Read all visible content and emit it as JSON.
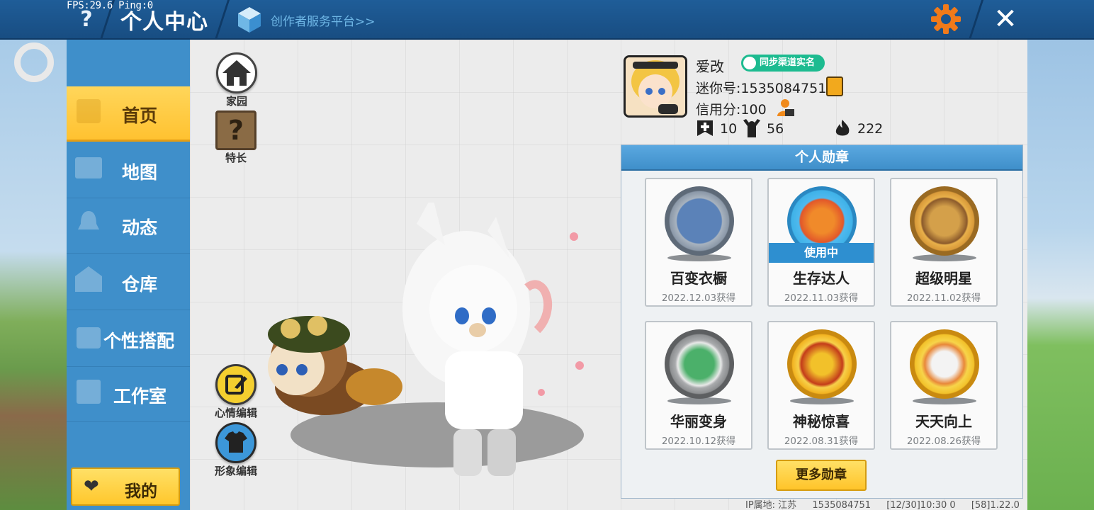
{
  "header": {
    "fps": "FPS:29.6  Ping:0",
    "title": "个人中心",
    "creator_link": "创作者服务平台>>",
    "icons": [
      "help-icon",
      "cube-icon",
      "gear-icon",
      "close-icon"
    ]
  },
  "sidebar": {
    "items": [
      {
        "label": "首页",
        "icon": "home-tile-icon",
        "active": true
      },
      {
        "label": "地图",
        "icon": "map-icon",
        "active": false
      },
      {
        "label": "动态",
        "icon": "bell-icon",
        "active": false
      },
      {
        "label": "仓库",
        "icon": "warehouse-icon",
        "active": false
      },
      {
        "label": "个性搭配",
        "icon": "outfit-icon",
        "active": false
      },
      {
        "label": "工作室",
        "icon": "studio-icon",
        "active": false
      }
    ],
    "my_button": "我的"
  },
  "stage": {
    "home_label": "家园",
    "talent_label": "特长",
    "talent_glyph": "?",
    "mood_label": "心情编辑",
    "look_label": "形象编辑"
  },
  "profile": {
    "nickname": "爱改",
    "sync_badge": "同步渠道实名",
    "mini_id": "迷你号:1535084751",
    "credit": "信用分:100",
    "stats": {
      "a": "10",
      "b": "56",
      "c": "222"
    }
  },
  "medals": {
    "header": "个人勋章",
    "in_use_label": "使用中",
    "items": [
      {
        "name": "百变衣橱",
        "date": "2022.12.03获得",
        "color": "#4a6fa5",
        "ring": "#8b98a8"
      },
      {
        "name": "生存达人",
        "date": "2022.11.03获得",
        "color": "#e2572a",
        "ring": "#3fb2e8",
        "in_use": true
      },
      {
        "name": "超级明星",
        "date": "2022.11.02获得",
        "color": "#8b5a2b",
        "ring": "#d99a3a"
      },
      {
        "name": "华丽变身",
        "date": "2022.10.12获得",
        "color": "#4bb06a",
        "ring": "#8d8f91"
      },
      {
        "name": "神秘惊喜",
        "date": "2022.08.31获得",
        "color": "#c43c1a",
        "ring": "#f2b321"
      },
      {
        "name": "天天向上",
        "date": "2022.08.26获得",
        "color": "#e8883a",
        "ring": "#f2c12a"
      }
    ],
    "more_button": "更多勋章"
  },
  "footer": {
    "ip": "IP属地: 江苏",
    "uid": "1535084751",
    "time": "[12/30]10:30 0",
    "version": "[58]1.22.0"
  }
}
